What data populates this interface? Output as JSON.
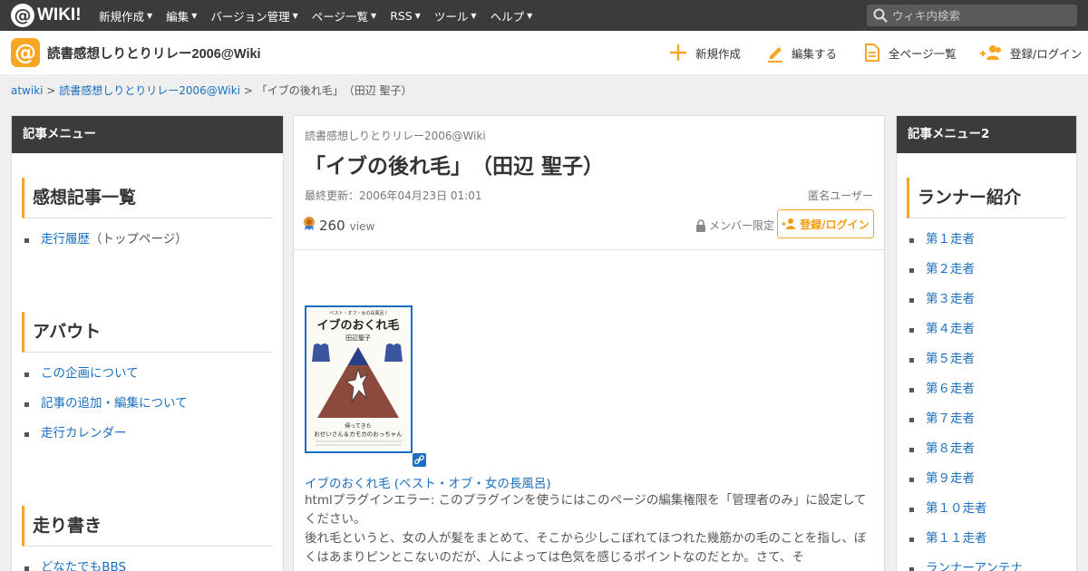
{
  "topbar": {
    "logo_text": "WIKI!",
    "menu": [
      {
        "label": "新規作成"
      },
      {
        "label": "編集"
      },
      {
        "label": "バージョン管理"
      },
      {
        "label": "ページ一覧"
      },
      {
        "label": "RSS"
      },
      {
        "label": "ツール"
      },
      {
        "label": "ヘルプ"
      }
    ],
    "search_placeholder": "ウィキ内検索"
  },
  "header": {
    "site_title": "読書感想しりとりリレー2006@Wiki",
    "actions": {
      "new": "新規作成",
      "edit": "編集する",
      "all_pages": "全ページ一覧",
      "login": "登録/ログイン"
    }
  },
  "breadcrumb": {
    "root": "atwiki",
    "sep1": ">",
    "site": "読書感想しりとりリレー2006@Wiki",
    "sep2": ">",
    "current": "「イブの後れ毛」　（田辺 聖子）"
  },
  "left_sidebar": {
    "title": "記事メニュー",
    "sections": [
      {
        "title": "感想記事一覧",
        "items": [
          {
            "label": "走行履歴",
            "note": "（トップページ）"
          }
        ]
      },
      {
        "title": "アバウト",
        "items": [
          {
            "label": "この企画について"
          },
          {
            "label": "記事の追加・編集について"
          },
          {
            "label": "走行カレンダー"
          }
        ]
      },
      {
        "title": "走り書き",
        "items": [
          {
            "label": "どなたでもBBS"
          }
        ]
      }
    ]
  },
  "main": {
    "wiki_name": "読書感想しりとりリレー2006@Wiki",
    "page_title": "「イブの後れ毛」　（田辺 聖子）",
    "last_updated": "最終更新：2006年04月23日 01:01",
    "author": "匿名ユーザー",
    "view_count": "260",
    "view_label": "view",
    "member_limit": "メンバー限定",
    "login_button": "登録/ログイン",
    "book": {
      "cover_series": "ベスト・オブ・女の長風呂 I",
      "cover_title": "イブのおくれ毛",
      "cover_author": "田辺聖子",
      "cover_tagline1": "帰ってきた",
      "cover_tagline2": "おせいさん＆カモカのおっちゃん",
      "link_text": "イブのおくれ毛 (ベスト・オブ・女の長風呂)"
    },
    "error_text": "htmlプラグインエラー: このプラグインを使うにはこのページの編集権限を「管理者のみ」に設定してください。",
    "body_text": "後れ毛というと、女の人が髪をまとめて、そこから少しこぼれてほつれた幾筋かの毛のことを指し、ぼくはあまりピンとこないのだが、人によっては色気を感じるポイントなのだとか。さて、そ"
  },
  "right_sidebar": {
    "title": "記事メニュー2",
    "section_title": "ランナー紹介",
    "items": [
      {
        "label": "第１走者"
      },
      {
        "label": "第２走者"
      },
      {
        "label": "第３走者"
      },
      {
        "label": "第４走者"
      },
      {
        "label": "第５走者"
      },
      {
        "label": "第６走者"
      },
      {
        "label": "第７走者"
      },
      {
        "label": "第８走者"
      },
      {
        "label": "第９走者"
      },
      {
        "label": "第１０走者"
      },
      {
        "label": "第１１走者"
      },
      {
        "label": "ランナーアンテナ"
      }
    ]
  },
  "colors": {
    "topbar": "#3b3b3b",
    "accent": "#f6a623",
    "link": "#1a6fc1",
    "background": "#efefef"
  }
}
